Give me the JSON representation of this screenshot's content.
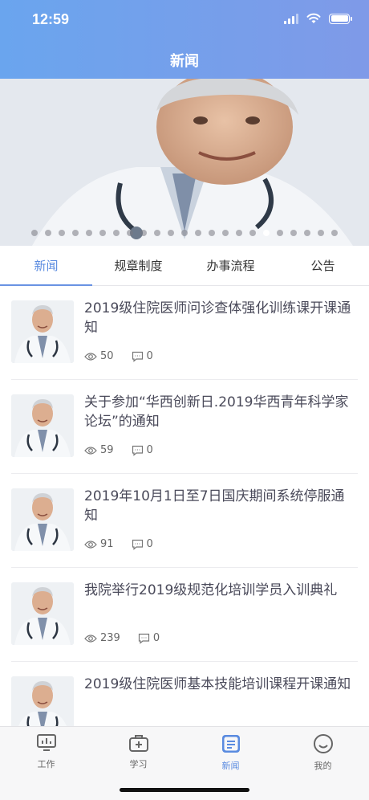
{
  "status": {
    "time": "12:59"
  },
  "nav": {
    "title": "新闻"
  },
  "banner": {
    "dots_count": 23,
    "active_dot": 17
  },
  "tabs": [
    {
      "label": "新闻",
      "active": true
    },
    {
      "label": "规章制度",
      "active": false
    },
    {
      "label": "办事流程",
      "active": false
    },
    {
      "label": "公告",
      "active": false
    }
  ],
  "news": [
    {
      "title": "2019级住院医师问诊查体强化训练课开课通知",
      "views": "50",
      "comments": "0"
    },
    {
      "title": "关于参加“华西创新日.2019华西青年科学家论坛”的通知",
      "views": "59",
      "comments": "0"
    },
    {
      "title": "2019年10月1日至7日国庆期间系统停服通知",
      "views": "91",
      "comments": "0"
    },
    {
      "title": "我院举行2019级规范化培训学员入训典礼",
      "views": "239",
      "comments": "0"
    },
    {
      "title": "2019级住院医师基本技能培训课程开课通知",
      "views": "",
      "comments": ""
    }
  ],
  "tabbar": [
    {
      "label": "工作",
      "icon": "monitor-icon",
      "active": false
    },
    {
      "label": "学习",
      "icon": "medical-kit-icon",
      "active": false
    },
    {
      "label": "新闻",
      "icon": "news-doc-icon",
      "active": true
    },
    {
      "label": "我的",
      "icon": "smiley-icon",
      "active": false
    }
  ],
  "colors": {
    "accent": "#5a8be0",
    "header_start": "#6aa5ee",
    "header_end": "#7f9ae8"
  }
}
